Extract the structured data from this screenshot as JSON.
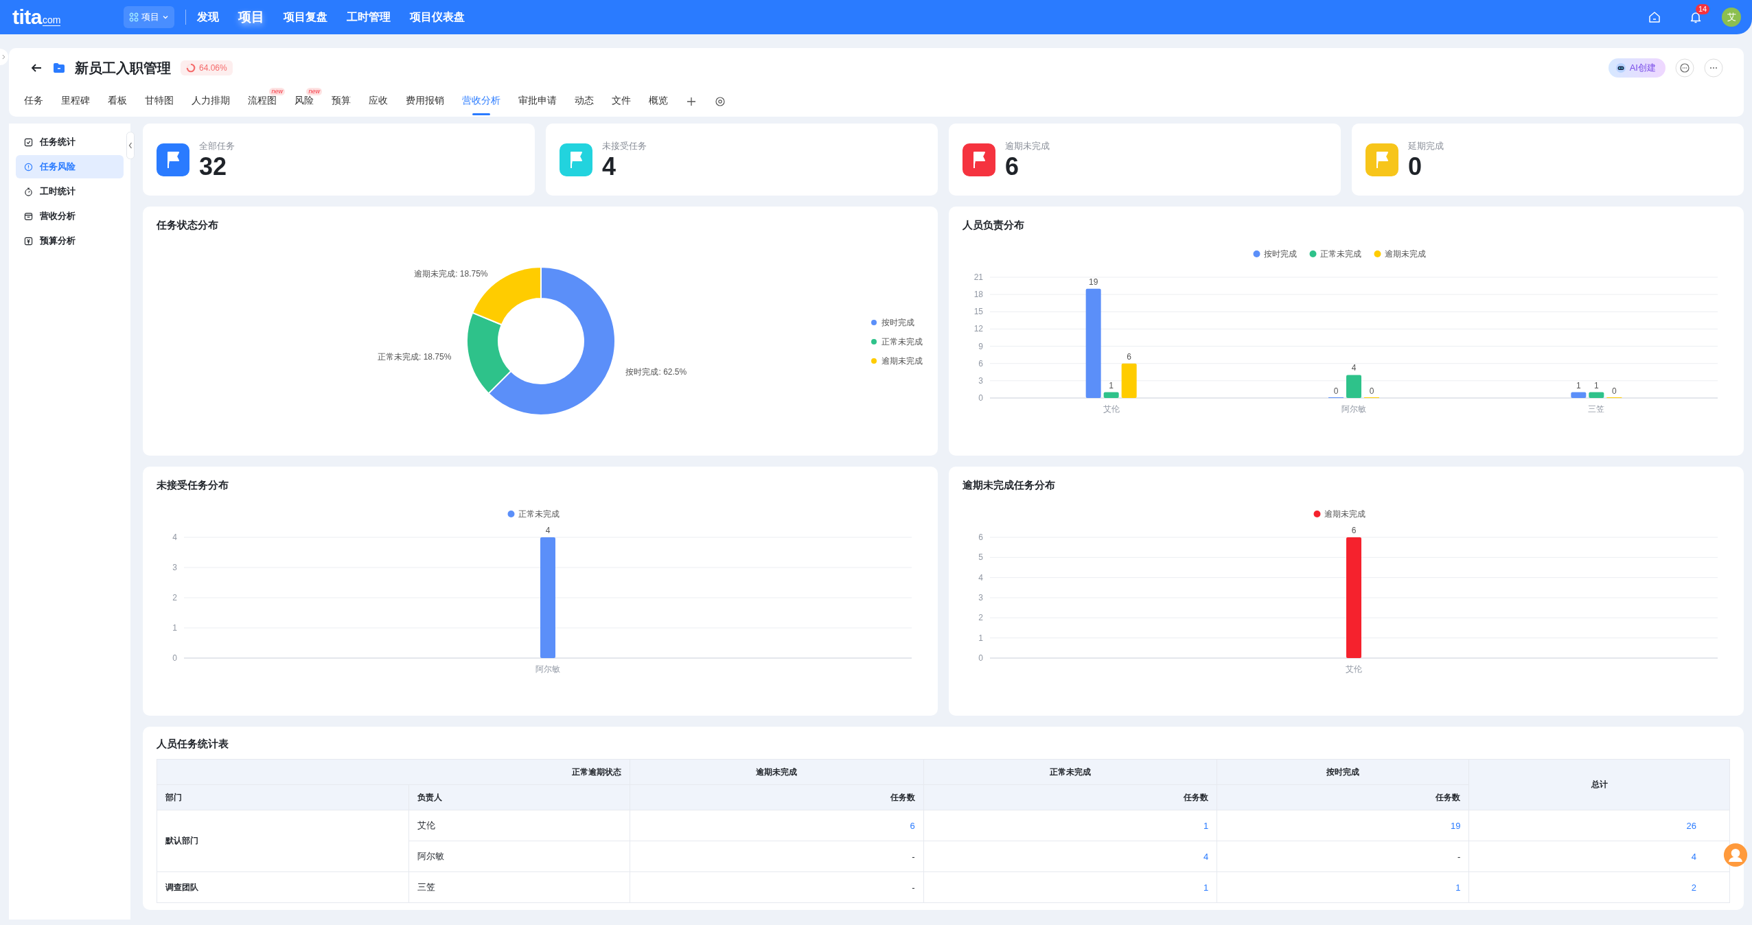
{
  "top_nav": {
    "logo": "tita",
    "logo_domain": "com",
    "module_switch": "项目",
    "links": [
      {
        "label": "发现",
        "selected": false
      },
      {
        "label": "项目",
        "selected": true
      },
      {
        "label": "项目复盘",
        "selected": false
      },
      {
        "label": "工时管理",
        "selected": false
      },
      {
        "label": "项目仪表盘",
        "selected": false
      }
    ],
    "notification_count": "14",
    "avatar": "艾"
  },
  "project": {
    "title": "新员工入职管理",
    "progress": "64.06%",
    "ai_button": "AI创建",
    "tabs": [
      {
        "label": "任务",
        "selected": false
      },
      {
        "label": "里程碑",
        "selected": false
      },
      {
        "label": "看板",
        "selected": false
      },
      {
        "label": "甘特图",
        "selected": false
      },
      {
        "label": "人力排期",
        "selected": false
      },
      {
        "label": "流程图",
        "selected": false,
        "badge": "new"
      },
      {
        "label": "风险",
        "selected": false,
        "badge": "new"
      },
      {
        "label": "预算",
        "selected": false
      },
      {
        "label": "应收",
        "selected": false
      },
      {
        "label": "费用报销",
        "selected": false
      },
      {
        "label": "营收分析",
        "selected": true
      },
      {
        "label": "审批申请",
        "selected": false
      },
      {
        "label": "动态",
        "selected": false
      },
      {
        "label": "文件",
        "selected": false
      },
      {
        "label": "概览",
        "selected": false
      }
    ]
  },
  "sidebar": {
    "items": [
      {
        "label": "任务统计",
        "selected": false
      },
      {
        "label": "任务风险",
        "selected": true
      },
      {
        "label": "工时统计",
        "selected": false
      },
      {
        "label": "营收分析",
        "selected": false
      },
      {
        "label": "预算分析",
        "selected": false
      }
    ]
  },
  "stats": [
    {
      "label": "全部任务",
      "value": "32",
      "color": "#2a7bff"
    },
    {
      "label": "未接受任务",
      "value": "4",
      "color": "#22d3de"
    },
    {
      "label": "逾期未完成",
      "value": "6",
      "color": "#f5333f"
    },
    {
      "label": "延期完成",
      "value": "0",
      "color": "#f7c51a"
    }
  ],
  "charts": [
    {
      "chart_data": {
        "type": "donut",
        "title": "任务状态分布",
        "categories": [
          "按时完成",
          "正常未完成",
          "逾期未完成"
        ],
        "colors": [
          "#5b8ff9",
          "#2ec28a",
          "#ffcc00"
        ],
        "values": [
          62.5,
          18.75,
          18.75
        ],
        "legend": true,
        "value_labels": [
          "按时完成: 62.5%",
          "正常未完成: 18.75%",
          "逾期未完成: 18.75%"
        ]
      }
    },
    {
      "chart_data": {
        "type": "bar",
        "title": "人员负责分布",
        "categories": [
          "艾伦",
          "阿尔敏",
          "三笠"
        ],
        "series": [
          {
            "name": "按时完成",
            "color": "#5b8ff9",
            "values": [
              19,
              0,
              1
            ]
          },
          {
            "name": "正常未完成",
            "color": "#2ec28a",
            "values": [
              1,
              4,
              1
            ]
          },
          {
            "name": "逾期未完成",
            "color": "#ffcc00",
            "values": [
              6,
              0,
              0
            ]
          }
        ],
        "ylim": [
          0,
          21
        ],
        "yticks": [
          0,
          3,
          6,
          9,
          12,
          15,
          18,
          21
        ],
        "data_labels": true,
        "legend": true,
        "grid": true
      }
    },
    {
      "chart_data": {
        "type": "bar",
        "title": "未接受任务分布",
        "categories": [
          "阿尔敏"
        ],
        "series": [
          {
            "name": "正常未完成",
            "color": "#5b8ff9",
            "values": [
              4
            ]
          }
        ],
        "ylim": [
          0,
          4
        ],
        "yticks": [
          0,
          1,
          2,
          3,
          4
        ],
        "data_labels": true,
        "legend": true,
        "grid": true
      }
    },
    {
      "chart_data": {
        "type": "bar",
        "title": "逾期未完成任务分布",
        "categories": [
          "艾伦"
        ],
        "series": [
          {
            "name": "逾期未完成",
            "color": "#f5222d",
            "values": [
              6
            ]
          }
        ],
        "ylim": [
          0,
          6
        ],
        "yticks": [
          0,
          1,
          2,
          3,
          4,
          5,
          6
        ],
        "data_labels": true,
        "legend": true,
        "grid": true
      }
    }
  ],
  "table": {
    "title": "人员任务统计表",
    "corner_label": "正常逾期状态",
    "status_columns": [
      "逾期未完成",
      "正常未完成",
      "按时完成"
    ],
    "total_column": "总计",
    "key_columns": [
      "部门",
      "负责人"
    ],
    "metric_labels": [
      "任务数",
      "任务数",
      "任务数"
    ],
    "groups": [
      {
        "department": "默认部门",
        "members": [
          {
            "name": "艾伦",
            "cells": [
              {
                "text": "6",
                "link": true
              },
              {
                "text": "1",
                "link": true
              },
              {
                "text": "19",
                "link": true
              },
              {
                "text": "26",
                "link": true
              }
            ]
          },
          {
            "name": "阿尔敏",
            "cells": [
              {
                "text": "-",
                "link": false
              },
              {
                "text": "4",
                "link": true
              },
              {
                "text": "-",
                "link": false
              },
              {
                "text": "4",
                "link": true
              }
            ]
          }
        ]
      },
      {
        "department": "调查团队",
        "members": [
          {
            "name": "三笠",
            "cells": [
              {
                "text": "-",
                "link": false
              },
              {
                "text": "1",
                "link": true
              },
              {
                "text": "1",
                "link": true
              },
              {
                "text": "2",
                "link": true
              }
            ]
          }
        ]
      }
    ]
  }
}
